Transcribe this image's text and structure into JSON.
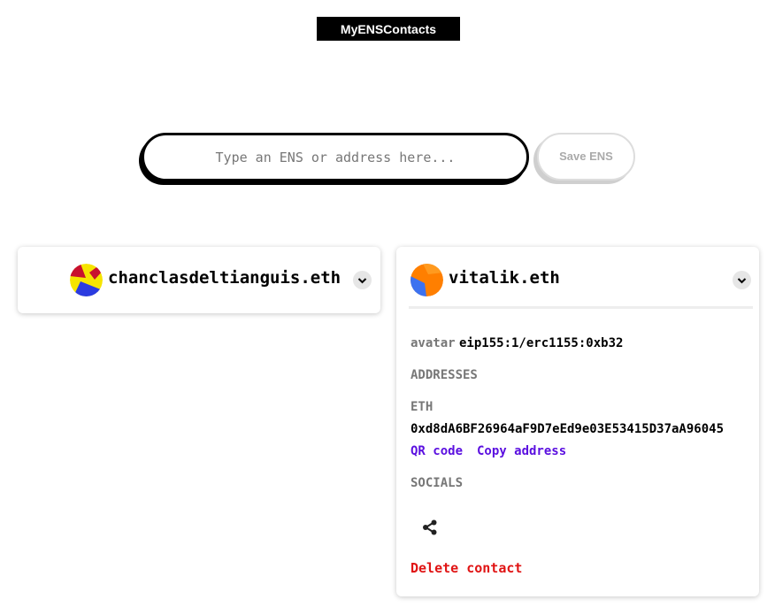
{
  "app": {
    "title": "MyENSContacts"
  },
  "search": {
    "placeholder": "Type an ENS or address here...",
    "value": "",
    "save_label": "Save ENS"
  },
  "contacts": [
    {
      "name": "chanclasdeltianguis.eth",
      "expanded": false,
      "avatar_colors": [
        "#f6e400",
        "#2b3be0",
        "#c8102e"
      ]
    },
    {
      "name": "vitalik.eth",
      "expanded": true,
      "avatar_colors": [
        "#ff7f00",
        "#3c72f0"
      ],
      "avatar_label": "avatar",
      "avatar_value": "eip155:1/erc1155:0xb32",
      "addresses_heading": "ADDRESSES",
      "eth_label": "ETH",
      "eth_address": "0xd8dA6BF26964aF9D7eEd9e03E53415D37aA96045",
      "qr_label": "QR code",
      "copy_label": "Copy address",
      "socials_heading": "SOCIALS",
      "share_icon": "share-icon",
      "delete_label": "Delete contact"
    }
  ],
  "colors": {
    "accent_link": "#5b10e0",
    "danger": "#e01414",
    "muted": "#777777"
  }
}
